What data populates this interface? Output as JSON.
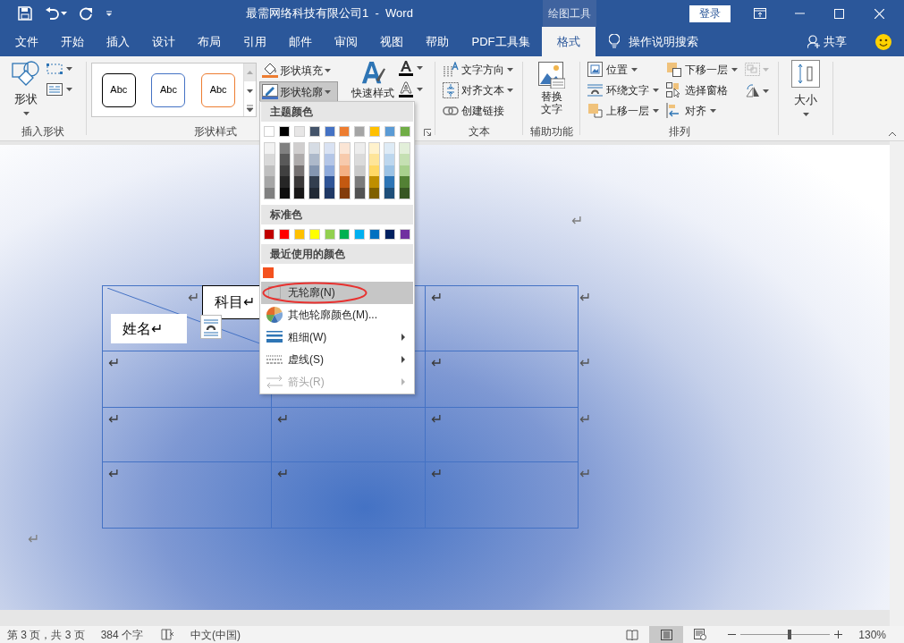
{
  "window": {
    "title": "最需网络科技有限公司1  -  Word",
    "context_group": "绘图工具",
    "sign_in": "登录"
  },
  "tabs": [
    {
      "label": "文件",
      "selected": false
    },
    {
      "label": "开始",
      "selected": false
    },
    {
      "label": "插入",
      "selected": false
    },
    {
      "label": "设计",
      "selected": false
    },
    {
      "label": "布局",
      "selected": false
    },
    {
      "label": "引用",
      "selected": false
    },
    {
      "label": "邮件",
      "selected": false
    },
    {
      "label": "审阅",
      "selected": false
    },
    {
      "label": "视图",
      "selected": false
    },
    {
      "label": "帮助",
      "selected": false
    },
    {
      "label": "PDF工具集",
      "selected": false
    },
    {
      "label": "格式",
      "selected": true
    }
  ],
  "tell_me": "操作说明搜索",
  "share": "共享",
  "ribbon": {
    "insert_shapes": {
      "label": "插入形状",
      "shapes": "形状"
    },
    "shape_styles": {
      "label": "形状样式",
      "gallery": [
        {
          "label": "Abc",
          "color": "#000000"
        },
        {
          "label": "Abc",
          "color": "#4472c4"
        },
        {
          "label": "Abc",
          "color": "#ed7d31"
        }
      ],
      "fill": "形状填充",
      "outline": {
        "label": "形状轮廓",
        "pressed": true
      }
    },
    "wordart_styles": {
      "quick_styles": "快速样式"
    },
    "text": {
      "label": "文本",
      "items": [
        {
          "kind": "direction",
          "label": "文字方向",
          "dropdown": true
        },
        {
          "kind": "align",
          "label": "对齐文本",
          "dropdown": true
        },
        {
          "kind": "link",
          "label": "创建链接",
          "dropdown": false
        }
      ]
    },
    "accessibility": {
      "label": "辅助功能",
      "alt_text": "替换文字"
    },
    "arrange": {
      "label": "排列",
      "items": [
        {
          "kind": "position",
          "label": "位置",
          "dropdown": true
        },
        {
          "kind": "wrap",
          "label": "环绕文字",
          "dropdown": true
        },
        {
          "kind": "forward",
          "label": "上移一层",
          "dropdown": true
        },
        {
          "kind": "backward",
          "label": "下移一层",
          "dropdown": true
        },
        {
          "kind": "pane",
          "label": "选择窗格",
          "dropdown": false
        },
        {
          "kind": "align",
          "label": "对齐",
          "dropdown": true
        }
      ]
    },
    "size": {
      "label": "大小"
    }
  },
  "outline_menu": {
    "theme_title": "主题颜色",
    "theme_colors": [
      {
        "color": "#ffffff",
        "shades": [
          {
            "color": "#f2f2f2"
          },
          {
            "color": "#d9d9d9"
          },
          {
            "color": "#bfbfbf"
          },
          {
            "color": "#a6a6a6"
          },
          {
            "color": "#808080"
          }
        ]
      },
      {
        "color": "#000000",
        "shades": [
          {
            "color": "#808080"
          },
          {
            "color": "#595959"
          },
          {
            "color": "#404040"
          },
          {
            "color": "#262626"
          },
          {
            "color": "#0d0d0d"
          }
        ]
      },
      {
        "color": "#e7e6e6",
        "shades": [
          {
            "color": "#d0cece"
          },
          {
            "color": "#aeabab"
          },
          {
            "color": "#757171"
          },
          {
            "color": "#3a3838"
          },
          {
            "color": "#171616"
          }
        ]
      },
      {
        "color": "#44546a",
        "shades": [
          {
            "color": "#d6dce4"
          },
          {
            "color": "#adb9ca"
          },
          {
            "color": "#8496b0"
          },
          {
            "color": "#333f4f"
          },
          {
            "color": "#222a35"
          }
        ]
      },
      {
        "color": "#4472c4",
        "shades": [
          {
            "color": "#d9e2f3"
          },
          {
            "color": "#b4c6e7"
          },
          {
            "color": "#8eaadb"
          },
          {
            "color": "#2f5496"
          },
          {
            "color": "#1f3864"
          }
        ]
      },
      {
        "color": "#ed7d31",
        "shades": [
          {
            "color": "#fbe5d5"
          },
          {
            "color": "#f7caac"
          },
          {
            "color": "#f4b083"
          },
          {
            "color": "#c45911"
          },
          {
            "color": "#833c0b"
          }
        ]
      },
      {
        "color": "#a5a5a5",
        "shades": [
          {
            "color": "#ededed"
          },
          {
            "color": "#dbdbdb"
          },
          {
            "color": "#c9c9c9"
          },
          {
            "color": "#7b7b7b"
          },
          {
            "color": "#525252"
          }
        ]
      },
      {
        "color": "#ffc000",
        "shades": [
          {
            "color": "#fff2cc"
          },
          {
            "color": "#fee599"
          },
          {
            "color": "#ffd965"
          },
          {
            "color": "#bf8f00"
          },
          {
            "color": "#7f6000"
          }
        ]
      },
      {
        "color": "#5b9bd5",
        "shades": [
          {
            "color": "#deebf6"
          },
          {
            "color": "#bdd7ee"
          },
          {
            "color": "#9cc3e5"
          },
          {
            "color": "#2e75b5"
          },
          {
            "color": "#1e4e79"
          }
        ]
      },
      {
        "color": "#70ad47",
        "shades": [
          {
            "color": "#e2efd9"
          },
          {
            "color": "#c5e0b3"
          },
          {
            "color": "#a8d08d"
          },
          {
            "color": "#538135"
          },
          {
            "color": "#375623"
          }
        ]
      }
    ],
    "standard_title": "标准色",
    "standard_colors": [
      {
        "color": "#c00000"
      },
      {
        "color": "#ff0000"
      },
      {
        "color": "#ffc000"
      },
      {
        "color": "#ffff00"
      },
      {
        "color": "#92d050"
      },
      {
        "color": "#00b050"
      },
      {
        "color": "#00b0f0"
      },
      {
        "color": "#0070c0"
      },
      {
        "color": "#002060"
      },
      {
        "color": "#7030a0"
      }
    ],
    "recent_title": "最近使用的颜色",
    "recent_colors": [
      {
        "color": "#f4511e"
      }
    ],
    "items": [
      {
        "kind": "none",
        "label": "无轮廓(N)",
        "highlighted": true,
        "circled": true,
        "submenu": false,
        "disabled": false
      },
      {
        "kind": "more",
        "label": "其他轮廓颜色(M)...",
        "highlighted": false,
        "circled": false,
        "submenu": false,
        "disabled": false
      },
      {
        "kind": "weight",
        "label": "粗细(W)",
        "highlighted": false,
        "circled": false,
        "submenu": true,
        "disabled": false
      },
      {
        "kind": "dashes",
        "label": "虚线(S)",
        "highlighted": false,
        "circled": false,
        "submenu": true,
        "disabled": false
      },
      {
        "kind": "arrows",
        "label": "箭头(R)",
        "highlighted": false,
        "circled": false,
        "submenu": true,
        "disabled": true
      }
    ]
  },
  "document": {
    "table": {
      "diagonal_header": true,
      "rows": [
        {
          "cells": [
            "↵",
            null,
            "↵"
          ],
          "end": "↵"
        },
        {
          "cells": [
            "↵",
            null,
            "↵"
          ],
          "end": "↵"
        },
        {
          "cells": [
            "↵",
            "↵",
            "↵"
          ],
          "end": "↵"
        },
        {
          "cells": [
            "↵",
            "↵",
            "↵"
          ],
          "end": "↵"
        }
      ]
    },
    "text_boxes": [
      {
        "text": "科目↵",
        "border": true
      },
      {
        "text": "姓名↵",
        "border": false
      }
    ],
    "paragraph_marks": [
      "↵",
      "↵"
    ]
  },
  "status_bar": {
    "page": "第 3 页，共 3 页",
    "words": "384 个字",
    "language": "中文(中国)",
    "views": [
      {
        "kind": "read",
        "selected": false
      },
      {
        "kind": "print",
        "selected": true
      },
      {
        "kind": "web",
        "selected": false
      }
    ],
    "zoom": {
      "level": 0.55,
      "reading": "130%"
    }
  }
}
